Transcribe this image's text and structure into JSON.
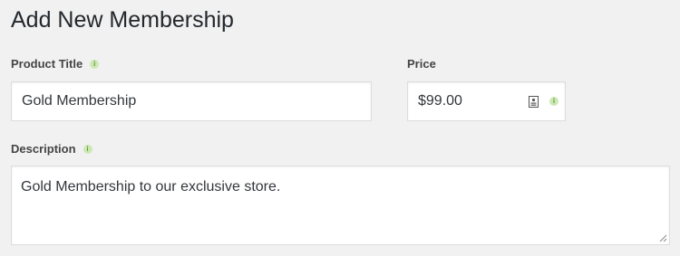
{
  "page": {
    "title": "Add New Membership"
  },
  "form": {
    "product_title": {
      "label": "Product Title",
      "value": "Gold Membership",
      "help_icon": "info-icon"
    },
    "price": {
      "label": "Price",
      "value": "$99.00",
      "field_icon": "contact-card-icon",
      "help_icon": "info-icon"
    },
    "description": {
      "label": "Description",
      "value": "Gold Membership to our exclusive store.",
      "help_icon": "info-icon"
    }
  },
  "colors": {
    "background": "#f1f1f1",
    "help_icon_bg": "#cde8b4",
    "border": "#dddddd"
  }
}
